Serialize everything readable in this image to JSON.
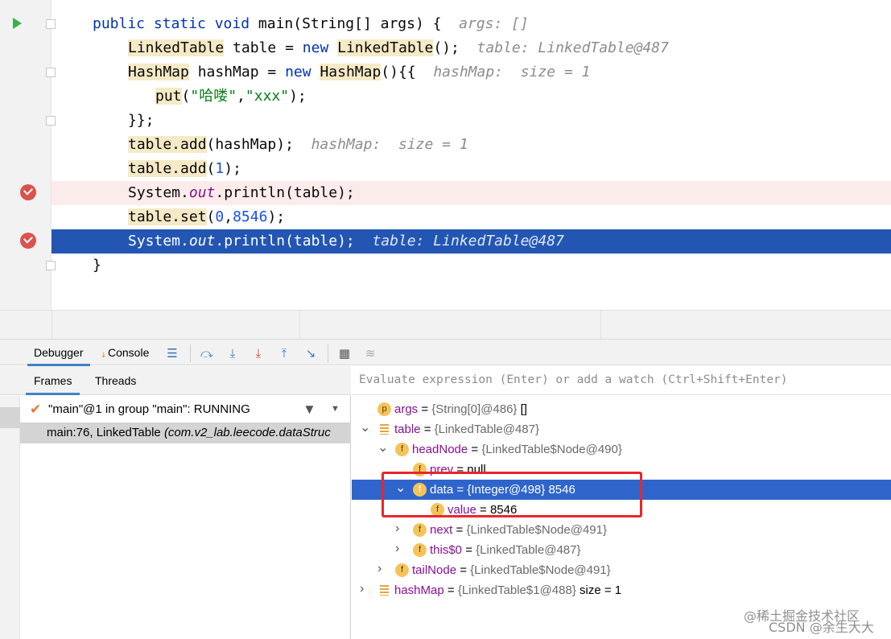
{
  "editor": {
    "lines": [
      {
        "parts": [
          {
            "c": "kw",
            "t": "public static void "
          },
          {
            "c": "",
            "t": "main(String[] args) {  "
          },
          {
            "c": "hint",
            "t": "args: []"
          }
        ]
      },
      {
        "parts": [
          {
            "c": "hl",
            "t": "LinkedTable"
          },
          {
            "c": "",
            "t": " table = "
          },
          {
            "c": "kw",
            "t": "new "
          },
          {
            "c": "hl",
            "t": "LinkedTable"
          },
          {
            "c": "",
            "t": "();  "
          },
          {
            "c": "hint",
            "t": "table: LinkedTable@487"
          }
        ]
      },
      {
        "parts": [
          {
            "c": "hl",
            "t": "HashMap"
          },
          {
            "c": "",
            "t": " hashMap = "
          },
          {
            "c": "kw",
            "t": "new "
          },
          {
            "c": "hl",
            "t": "HashMap"
          },
          {
            "c": "",
            "t": "(){{  "
          },
          {
            "c": "hint",
            "t": "hashMap:  size = 1"
          }
        ]
      },
      {
        "parts": [
          {
            "c": "hl",
            "t": "put"
          },
          {
            "c": "",
            "t": "("
          },
          {
            "c": "str",
            "t": "\"哈喽\""
          },
          {
            "c": "",
            "t": ","
          },
          {
            "c": "str",
            "t": "\"xxx\""
          },
          {
            "c": "",
            "t": ");"
          }
        ]
      },
      {
        "parts": [
          {
            "c": "",
            "t": "}};"
          }
        ]
      },
      {
        "parts": [
          {
            "c": "hl",
            "t": "table.add"
          },
          {
            "c": "",
            "t": "(hashMap);  "
          },
          {
            "c": "hint",
            "t": "hashMap:  size = 1"
          }
        ]
      },
      {
        "parts": [
          {
            "c": "hl",
            "t": "table.add"
          },
          {
            "c": "",
            "t": "("
          },
          {
            "c": "num",
            "t": "1"
          },
          {
            "c": "",
            "t": ");"
          }
        ]
      },
      {
        "parts": [
          {
            "c": "",
            "t": "System."
          },
          {
            "c": "fld",
            "t": "out"
          },
          {
            "c": "",
            "t": ".println(table);"
          }
        ]
      },
      {
        "parts": [
          {
            "c": "hl",
            "t": "table.set"
          },
          {
            "c": "",
            "t": "("
          },
          {
            "c": "num",
            "t": "0"
          },
          {
            "c": "",
            "t": ","
          },
          {
            "c": "num",
            "t": "8546"
          },
          {
            "c": "",
            "t": ");"
          }
        ]
      },
      {
        "parts": [
          {
            "c": "",
            "t": "System."
          },
          {
            "c": "fld",
            "t": "out"
          },
          {
            "c": "",
            "t": ".println(table);  "
          },
          {
            "c": "hint",
            "t": "table: LinkedTable@487"
          }
        ]
      },
      {
        "parts": [
          {
            "c": "",
            "t": "}"
          }
        ]
      }
    ]
  },
  "toolbar": {
    "debugger_tab": "Debugger",
    "console_tab": "Console",
    "icons": [
      "menu-icon",
      "step-over-icon",
      "step-into-icon",
      "force-step-into-icon",
      "step-out-icon",
      "run-to-cursor-icon",
      "evaluate-icon",
      "trace-icon"
    ]
  },
  "frames": {
    "tab_frames": "Frames",
    "tab_threads": "Threads",
    "thread": "\"main\"@1 in group \"main\": RUNNING",
    "frame_main": "main:76, LinkedTable ",
    "frame_pkg": "(com.v2_lab.leecode.dataStruc"
  },
  "variables": {
    "watch_placeholder": "Evaluate expression (Enter) or add a watch (Ctrl+Shift+Enter)",
    "rows": [
      {
        "arrow": "",
        "icon": "p",
        "name": "args",
        "eq": " = ",
        "type": "{String[0]@486}",
        "val": " []"
      },
      {
        "arrow": "v",
        "icon": "list",
        "name": "table",
        "eq": " = ",
        "type": "{LinkedTable@487}",
        "val": ""
      },
      {
        "arrow": "v",
        "icon": "f",
        "name": "headNode",
        "eq": " = ",
        "type": "{LinkedTable$Node@490}",
        "val": ""
      },
      {
        "arrow": "",
        "icon": "f",
        "name": "prev",
        "eq": " = ",
        "type": "",
        "val": "null"
      },
      {
        "arrow": "v",
        "icon": "f",
        "name": "data",
        "eq": " = ",
        "type": "{Integer@498}",
        "val": " 8546"
      },
      {
        "arrow": "",
        "icon": "f",
        "name": "value",
        "eq": " = ",
        "type": "",
        "val": "8546"
      },
      {
        "arrow": ">",
        "icon": "f",
        "name": "next",
        "eq": " = ",
        "type": "{LinkedTable$Node@491}",
        "val": ""
      },
      {
        "arrow": ">",
        "icon": "f",
        "name": "this$0",
        "eq": " = ",
        "type": "{LinkedTable@487}",
        "val": ""
      },
      {
        "arrow": ">",
        "icon": "f",
        "name": "tailNode",
        "eq": " = ",
        "type": "{LinkedTable$Node@491}",
        "val": ""
      },
      {
        "arrow": ">",
        "icon": "list",
        "name": "hashMap",
        "eq": " = ",
        "type": "{LinkedTable$1@488}",
        "val": "  size = 1"
      }
    ]
  },
  "watermark": {
    "line1": "@稀土掘金技术社区",
    "line2": "CSDN @余生大大"
  }
}
